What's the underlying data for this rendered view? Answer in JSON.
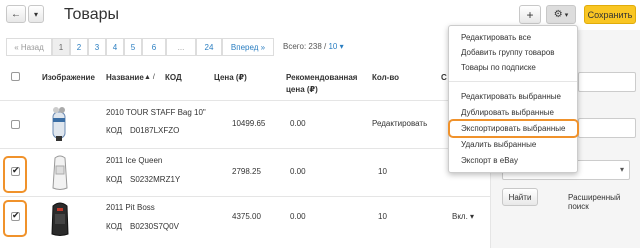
{
  "toolbar": {
    "back_icon": "←",
    "caret_icon": "▾",
    "title": "Товары",
    "add_icon": "+",
    "gear_icon": "⚙",
    "save_label": "Сохранить"
  },
  "pagination": {
    "prev": "« Назад",
    "pages": [
      "1",
      "2",
      "3",
      "4",
      "5",
      "6",
      "...",
      "24"
    ],
    "next": "Вперед »",
    "total_label": "Всего: 238 /",
    "per_page": "10 ▾"
  },
  "table": {
    "headers": {
      "image": "Изображение",
      "name": "Название",
      "sort_icon": "▲ /",
      "code": "КОД",
      "price": "Цена (₽)",
      "rec_price_1": "Рекомендованная",
      "rec_price_2": "цена (₽)",
      "qty": "Кол-во",
      "status": "С"
    },
    "rows": [
      {
        "name": "2010 TOUR STAFF Bag 10\"",
        "code_label": "КОД",
        "code": "D0187LXFZO",
        "price": "10499.65",
        "rec_price": "0.00",
        "qty_action": "Редактировать",
        "checked": false
      },
      {
        "name": "2011 Ice Queen",
        "code_label": "КОД",
        "code": "S0232MRZ1Y",
        "price": "2798.25",
        "rec_price": "0.00",
        "qty": "10",
        "checked": true
      },
      {
        "name": "2011 Pit Boss",
        "code_label": "КОД",
        "code": "B0230S7Q0V",
        "price": "4375.00",
        "rec_price": "0.00",
        "qty": "10",
        "status": "Вкл. ▾",
        "checked": true
      }
    ]
  },
  "menu": {
    "items": [
      "Редактировать все",
      "Добавить группу товаров",
      "Товары по подписке",
      "Редактировать выбранные",
      "Дублировать выбранные",
      "Экспортировать выбранные",
      "Удалить выбранные",
      "Экспорт в eBay"
    ]
  },
  "sidebar": {
    "search_button": "Найти",
    "advanced_search": "Расширенный поиск"
  },
  "colors": {
    "accent_link": "#2a7ec1",
    "highlight": "#f0922b",
    "save_button": "#f9c623"
  }
}
